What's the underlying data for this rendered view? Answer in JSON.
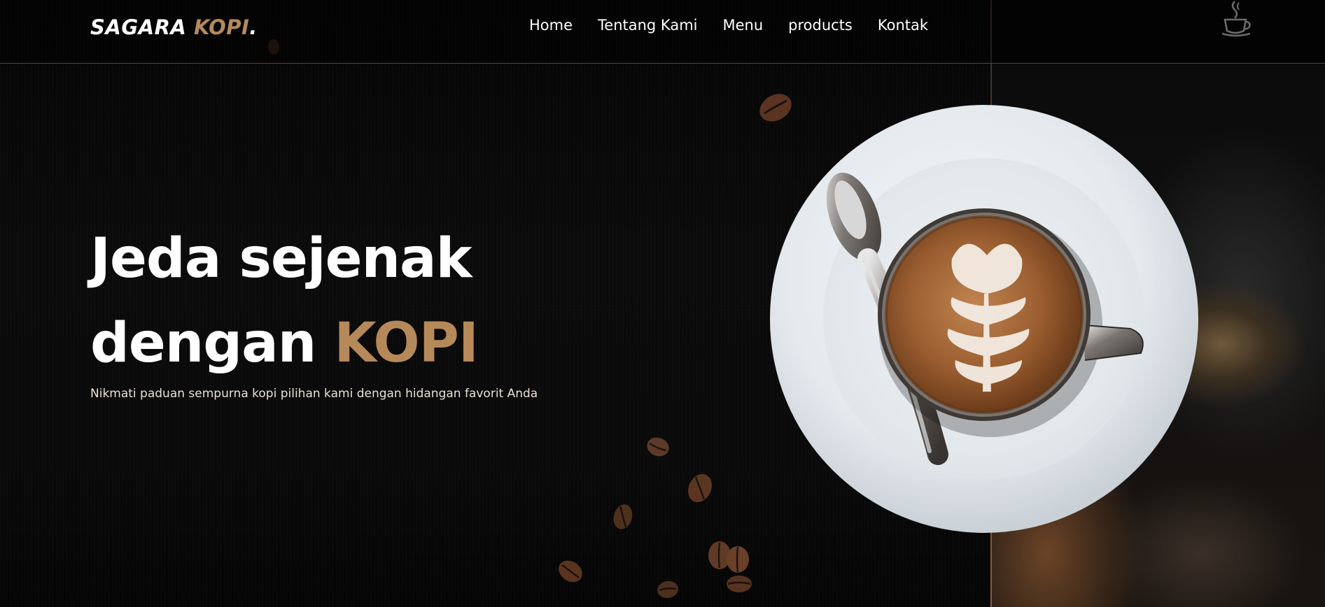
{
  "brand": {
    "name": "SAGARA ",
    "accent": "KOPI",
    "dot": "."
  },
  "nav": {
    "items": [
      "Home",
      "Tentang Kami",
      "Menu",
      "products",
      "Kontak"
    ]
  },
  "hero": {
    "line1": "Jeda sejenak",
    "line2_prefix": "dengan ",
    "line2_accent": "KOPI",
    "subtitle": "Nikmati paduan sempurna kopi pilihan kami dengan hidangan favorit Anda"
  },
  "icons": {
    "header_right": "coffee-cup-icon"
  },
  "colors": {
    "accent": "#b6895b",
    "background": "#060606",
    "text": "#ffffff"
  }
}
